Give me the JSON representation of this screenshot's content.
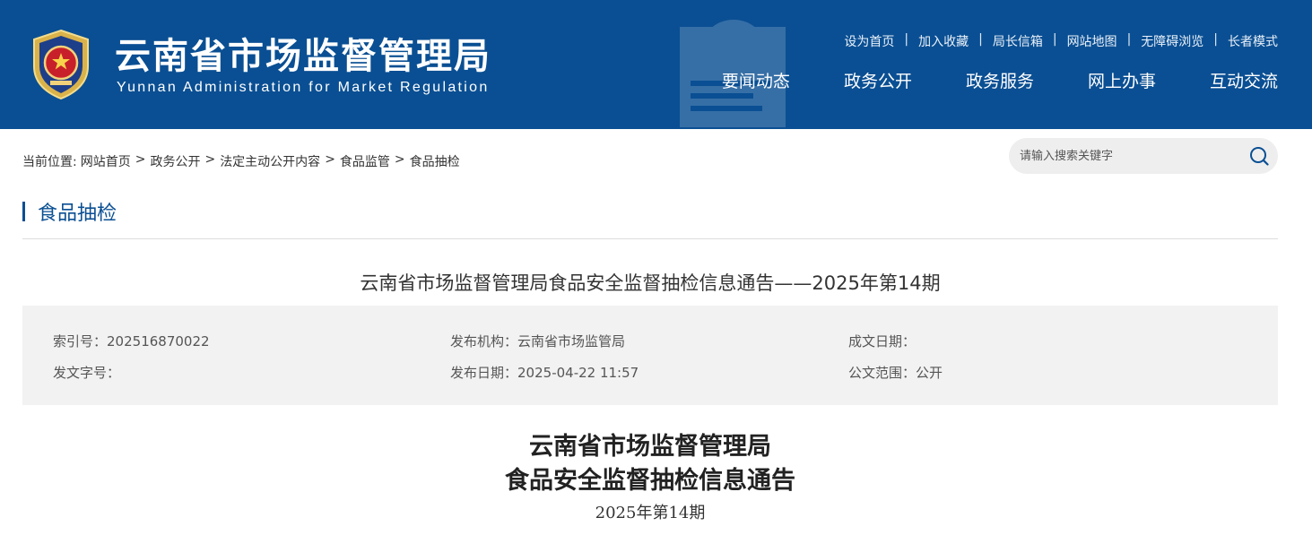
{
  "header": {
    "site_name": "云南省市场监督管理局",
    "site_name_en": "Yunnan Administration for Market Regulation",
    "top_links": [
      "设为首页",
      "加入收藏",
      "局长信箱",
      "网站地图",
      "无障碍浏览",
      "长者模式"
    ],
    "nav": [
      "要闻动态",
      "政务公开",
      "政务服务",
      "网上办事",
      "互动交流"
    ],
    "brand_color": "#0a4f93"
  },
  "breadcrumb": {
    "prefix": "当前位置:",
    "items": [
      "网站首页",
      "政务公开",
      "法定主动公开内容",
      "食品监管",
      "食品抽检"
    ],
    "separator": ">"
  },
  "search": {
    "placeholder": "请输入搜索关键字",
    "icon": "search-icon"
  },
  "section": {
    "title": "食品抽检"
  },
  "article": {
    "title": "云南省市场监督管理局食品安全监督抽检信息通告——2025年第14期",
    "meta": {
      "index_label": "索引号：",
      "index_value": "202516870022",
      "publisher_label": "发布机构：",
      "publisher_value": "云南省市场监管局",
      "created_label": "成文日期：",
      "created_value": "",
      "doc_no_label": "发文字号：",
      "doc_no_value": "",
      "publish_date_label": "发布日期：",
      "publish_date_value": "2025-04-22 11:57",
      "scope_label": "公文范围：",
      "scope_value": "公开"
    },
    "doc_heading_line1": "云南省市场监督管理局",
    "doc_heading_line2": "食品安全监督抽检信息通告",
    "doc_issue": "2025年第14期"
  }
}
